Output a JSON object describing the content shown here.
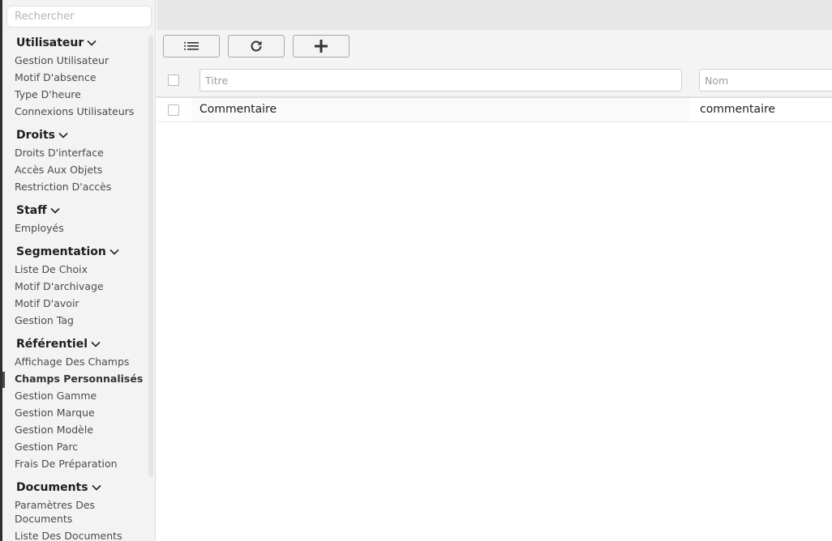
{
  "sidebar": {
    "search_placeholder": "Rechercher",
    "groups": [
      {
        "title": "Utilisateur",
        "items": [
          "Gestion Utilisateur",
          "Motif D'absence",
          "Type D'heure",
          "Connexions Utilisateurs"
        ]
      },
      {
        "title": "Droits",
        "items": [
          "Droits D'interface",
          "Accès Aux Objets",
          "Restriction D'accès"
        ]
      },
      {
        "title": "Staff",
        "items": [
          "Employés"
        ]
      },
      {
        "title": "Segmentation",
        "items": [
          "Liste De Choix",
          "Motif D'archivage",
          "Motif D'avoir",
          "Gestion Tag"
        ]
      },
      {
        "title": "Référentiel",
        "items": [
          "Affichage Des Champs",
          "Champs Personnalisés",
          "Gestion Gamme",
          "Gestion Marque",
          "Gestion Modèle",
          "Gestion Parc",
          "Frais De Préparation"
        ]
      },
      {
        "title": "Documents",
        "items": [
          "Paramètres Des",
          "Documents",
          "Liste Des Documents"
        ]
      }
    ],
    "active_item": "Champs Personnalisés"
  },
  "toolbar": {
    "list_icon": "list-icon",
    "refresh_icon": "refresh-icon",
    "add_icon": "plus-icon"
  },
  "grid": {
    "filters": {
      "title_placeholder": "Titre",
      "name_placeholder": "Nom"
    },
    "rows": [
      {
        "title": "Commentaire",
        "name": "commentaire"
      }
    ]
  }
}
